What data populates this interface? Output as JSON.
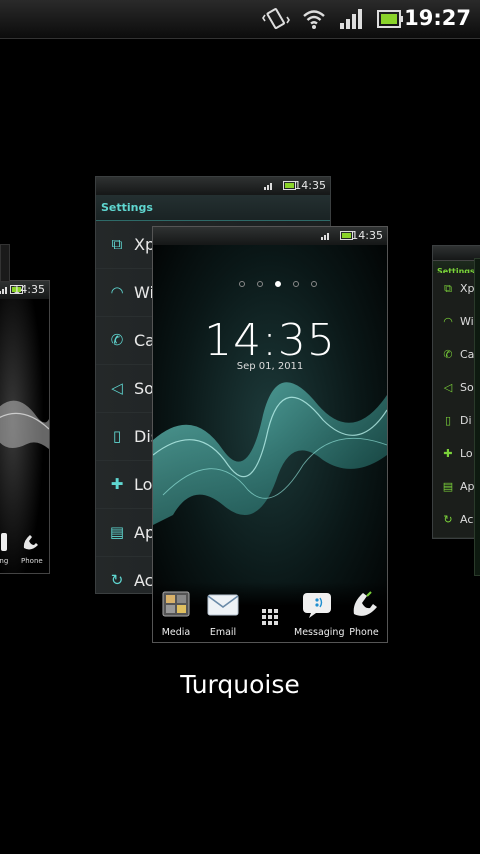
{
  "status_bar": {
    "time": "19:27",
    "icons": [
      "vibrate-icon",
      "wifi-icon",
      "signal-icon",
      "battery-icon"
    ]
  },
  "left_preview": {
    "time": "14:35",
    "dock_labels": [
      "ging",
      "Phone"
    ]
  },
  "settings_preview": {
    "time": "14:35",
    "title": "Settings",
    "items": [
      {
        "icon": "xperia-icon",
        "label": "Xp"
      },
      {
        "icon": "wifi-icon",
        "label": "Wi"
      },
      {
        "icon": "call-icon",
        "label": "Ca"
      },
      {
        "icon": "sound-icon",
        "label": "So"
      },
      {
        "icon": "display-icon",
        "label": "Dis"
      },
      {
        "icon": "location-icon",
        "label": "Lo"
      },
      {
        "icon": "apps-icon",
        "label": "Ap"
      },
      {
        "icon": "sync-icon",
        "label": "Ac"
      }
    ]
  },
  "front_preview": {
    "time": "14:35",
    "clock": "14:35",
    "date": "Sep 01, 2011",
    "page_indicator": {
      "count": 5,
      "active": 3
    },
    "dock": [
      {
        "icon": "media-icon",
        "label": "Media"
      },
      {
        "icon": "email-icon",
        "label": "Email"
      },
      {
        "icon": "app-drawer-icon",
        "label": ""
      },
      {
        "icon": "messaging-icon",
        "label": "Messaging"
      },
      {
        "icon": "phone-icon",
        "label": "Phone"
      }
    ]
  },
  "right_preview": {
    "title": "Settings",
    "items": [
      {
        "icon": "xperia-icon",
        "label": "Xp"
      },
      {
        "icon": "wifi-icon",
        "label": "Wi"
      },
      {
        "icon": "call-icon",
        "label": "Ca"
      },
      {
        "icon": "sound-icon",
        "label": "So"
      },
      {
        "icon": "display-icon",
        "label": "Di"
      },
      {
        "icon": "location-icon",
        "label": "Lo"
      },
      {
        "icon": "apps-icon",
        "label": "Ap"
      },
      {
        "icon": "sync-icon",
        "label": "Ac"
      }
    ]
  },
  "theme_name": "Turquoise",
  "colors": {
    "accent_turquoise": "#5fd6d0",
    "accent_green": "#7bd23a",
    "background": "#000000"
  }
}
